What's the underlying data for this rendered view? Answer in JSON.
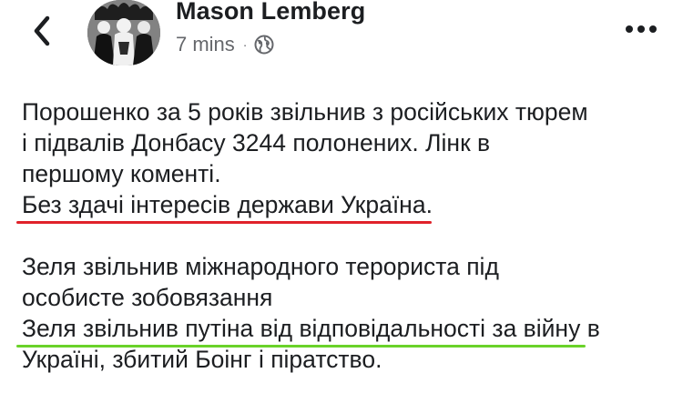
{
  "header": {
    "author": "Mason Lemberg",
    "time": "7 mins",
    "separator": "·",
    "privacy_icon": "globe-icon",
    "back_icon": "chevron-left-icon",
    "more_icon": "more-horizontal-icon"
  },
  "post": {
    "paragraph1": {
      "line1": "Порошенко за 5 років звільнив з російських тюрем",
      "line2": "і підвалів Донбасу 3244 полонених. Лінк в",
      "line3": "першому коменті.",
      "line4_highlight": "Без здачі інтересів держави Україна",
      "line4_after": "."
    },
    "paragraph2": {
      "line1": "Зеля звільнив міжнародного терориста під",
      "line2": "особисте зобовязання",
      "line3_highlight": "Зеля звільнив путіна від відповідальності за війну",
      "line3_after": " в",
      "line4": "Україні, збитий Боінг і піратство."
    }
  },
  "colors": {
    "text": "#1c1e21",
    "meta": "#65676b",
    "underline_red": "#e0222a",
    "underline_green": "#6ad22a"
  }
}
